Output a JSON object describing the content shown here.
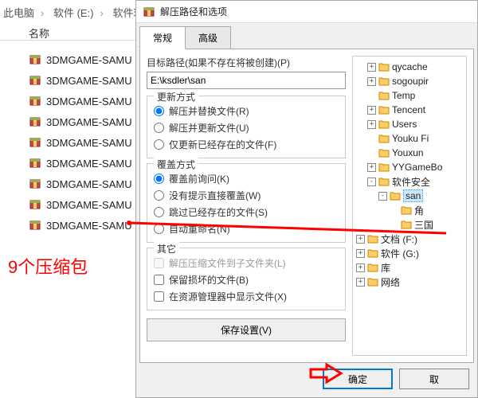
{
  "breadcrumb": {
    "parts": [
      "此电脑",
      "软件 (E:)",
      "软件玩"
    ]
  },
  "explorer": {
    "column_header": "名称",
    "files": [
      "3DMGAME-SAMU",
      "3DMGAME-SAMU",
      "3DMGAME-SAMU",
      "3DMGAME-SAMU",
      "3DMGAME-SAMU",
      "3DMGAME-SAMU",
      "3DMGAME-SAMU",
      "3DMGAME-SAMU",
      "3DMGAME-SAMU"
    ]
  },
  "annotations": {
    "red_note": "9个压缩包"
  },
  "dialog": {
    "title": "解压路径和选项",
    "tabs": {
      "general": "常规",
      "advanced": "高级"
    },
    "dest_label": "目标路径(如果不存在将被创建)(P)",
    "dest_value": "E:\\ksdler\\san",
    "update_group": {
      "title": "更新方式",
      "opt1": "解压并替换文件(R)",
      "opt2": "解压并更新文件(U)",
      "opt3": "仅更新已经存在的文件(F)"
    },
    "overwrite_group": {
      "title": "覆盖方式",
      "opt1": "覆盖前询问(K)",
      "opt2": "没有提示直接覆盖(W)",
      "opt3": "跳过已经存在的文件(S)",
      "opt4": "自动重命名(N)"
    },
    "misc_group": {
      "title": "其它",
      "opt1": "解压压缩文件到子文件夹(L)",
      "opt2": "保留损坏的文件(B)",
      "opt3": "在资源管理器中显示文件(X)"
    },
    "save_btn": "保存设置(V)",
    "tree": [
      {
        "indent": 1,
        "exp": "+",
        "type": "folder",
        "label": "qycache"
      },
      {
        "indent": 1,
        "exp": "+",
        "type": "folder",
        "label": "sogoupir"
      },
      {
        "indent": 1,
        "exp": "",
        "type": "folder",
        "label": "Temp"
      },
      {
        "indent": 1,
        "exp": "+",
        "type": "folder",
        "label": "Tencent"
      },
      {
        "indent": 1,
        "exp": "+",
        "type": "folder",
        "label": "Users"
      },
      {
        "indent": 1,
        "exp": "",
        "type": "folder",
        "label": "Youku Fi"
      },
      {
        "indent": 1,
        "exp": "",
        "type": "folder",
        "label": "Youxun"
      },
      {
        "indent": 1,
        "exp": "+",
        "type": "folder",
        "label": "YYGameBo"
      },
      {
        "indent": 1,
        "exp": "-",
        "type": "folder",
        "label": "软件安全"
      },
      {
        "indent": 2,
        "exp": "-",
        "type": "folder",
        "label": "san",
        "sel": true
      },
      {
        "indent": 3,
        "exp": "",
        "type": "folder",
        "label": "角"
      },
      {
        "indent": 3,
        "exp": "",
        "type": "folder",
        "label": "三国"
      },
      {
        "indent": 0,
        "exp": "+",
        "type": "folder",
        "label": "文档 (F:)"
      },
      {
        "indent": 0,
        "exp": "+",
        "type": "folder",
        "label": "软件 (G:)"
      },
      {
        "indent": 0,
        "exp": "+",
        "type": "lib",
        "label": "库"
      },
      {
        "indent": 0,
        "exp": "+",
        "type": "net",
        "label": "网络"
      }
    ],
    "ok": "确定",
    "cancel": "取"
  }
}
